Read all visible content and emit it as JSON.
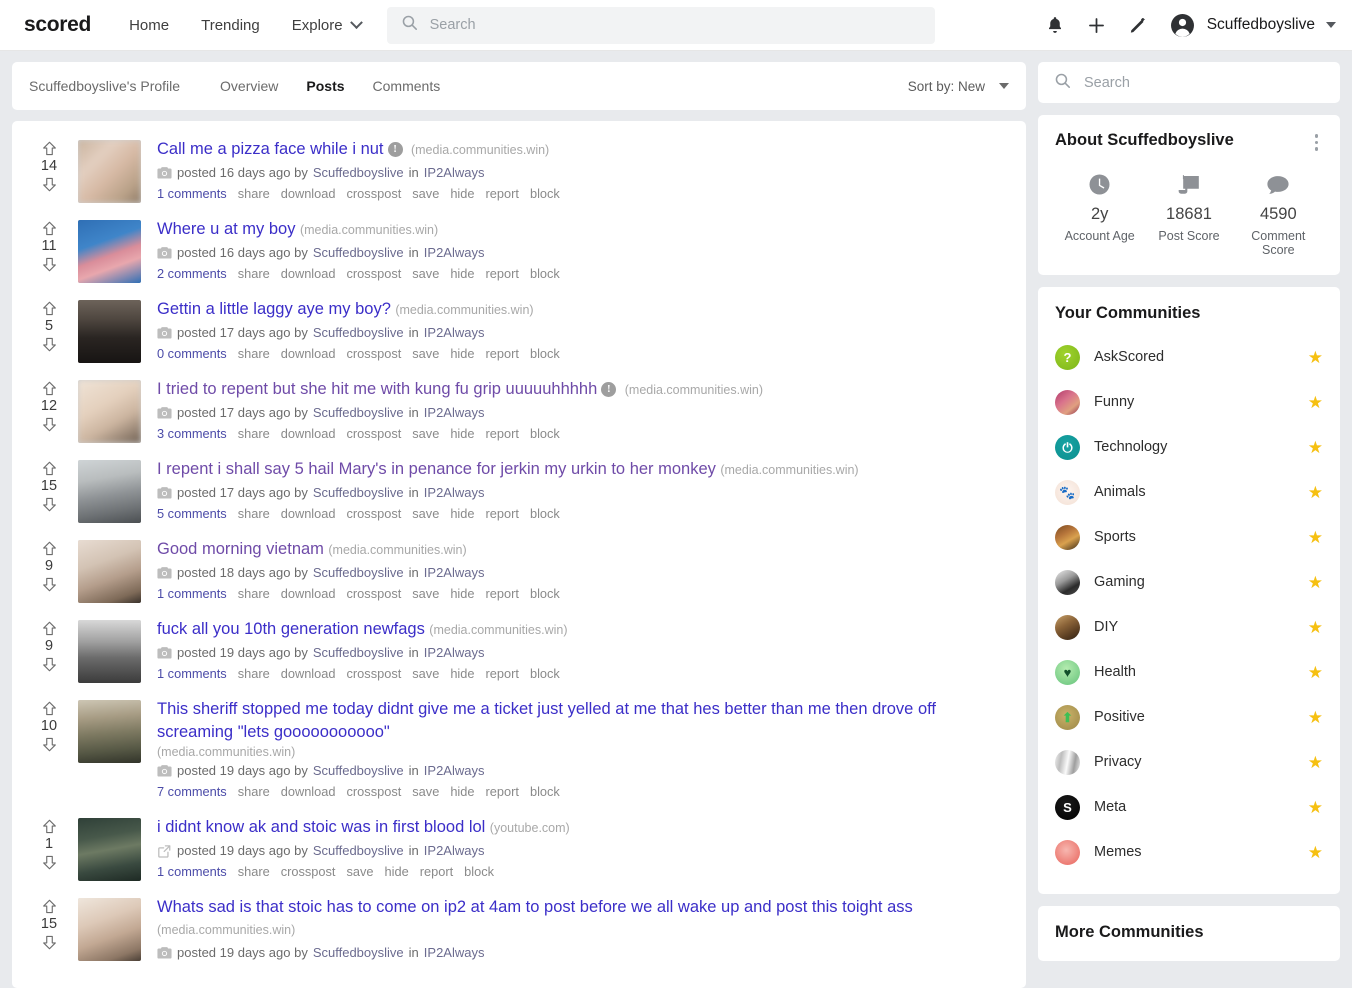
{
  "navbar": {
    "brand": "scored",
    "links": [
      {
        "label": "Home",
        "name": "nav-home"
      },
      {
        "label": "Trending",
        "name": "nav-trending"
      }
    ],
    "explore": "Explore",
    "search_placeholder": "Search",
    "search_value": "",
    "icons": [
      "bell-icon",
      "plus-icon",
      "pencil-icon",
      "account-icon"
    ],
    "username": "Scuffedboyslive"
  },
  "profile_header": {
    "profile_label": "Scuffedboyslive's Profile",
    "tabs": [
      {
        "label": "Overview",
        "active": false
      },
      {
        "label": "Posts",
        "active": true
      },
      {
        "label": "Comments",
        "active": false
      }
    ],
    "sort_label": "Sort by: New"
  },
  "posts": [
    {
      "score": "14",
      "title": "Call me a pizza face while i nut",
      "nsfw": true,
      "domain": "(media.communities.win)",
      "kind": "camera-icon",
      "posted": "posted 16 days ago by",
      "author": "Scuffedboyslive",
      "in": "in",
      "community": "IP2Always",
      "comments": "1 comments",
      "actions": [
        "share",
        "download",
        "crosspost",
        "save",
        "hide",
        "report",
        "block"
      ],
      "thumb": "blurred-nsfw-thumbnail",
      "thumb_css": "linear-gradient(135deg,#c9b39e 0%,#e3cfc0 30%,#d6b9a4 55%,#b9a188 80%,#8e7a66 100%)",
      "visited": false
    },
    {
      "score": "11",
      "title": "Where u at my boy",
      "nsfw": false,
      "domain": "(media.communities.win)",
      "kind": "camera-icon",
      "posted": "posted 16 days ago by",
      "author": "Scuffedboyslive",
      "in": "in",
      "community": "IP2Always",
      "comments": "2 comments",
      "actions": [
        "share",
        "download",
        "crosspost",
        "save",
        "hide",
        "report",
        "block"
      ],
      "thumb": "pink-octopus-on-blue-thumbnail",
      "thumb_css": "linear-gradient(160deg,#2f6fb5 0%,#3f85c9 35%,#d98d9a 55%,#e8a7ad 70%,#2f6fb5 100%)",
      "visited": false
    },
    {
      "score": "5",
      "title": "Gettin a little laggy aye my boy?",
      "nsfw": false,
      "domain": "(media.communities.win)",
      "kind": "camera-icon",
      "posted": "posted 17 days ago by",
      "author": "Scuffedboyslive",
      "in": "in",
      "community": "IP2Always",
      "comments": "0 comments",
      "actions": [
        "share",
        "download",
        "crosspost",
        "save",
        "hide",
        "report",
        "block"
      ],
      "thumb": "man-in-dark-room-thumbnail",
      "thumb_css": "linear-gradient(180deg,#6d635a 0%,#4f4740 30%,#2a2522 60%,#171413 100%)",
      "visited": false
    },
    {
      "score": "12",
      "title": "I tried to repent but she hit me with kung fu grip uuuuuhhhhh",
      "nsfw": true,
      "domain": "(media.communities.win)",
      "kind": "camera-icon",
      "posted": "posted 17 days ago by",
      "author": "Scuffedboyslive",
      "in": "in",
      "community": "IP2Always",
      "comments": "3 comments",
      "actions": [
        "share",
        "download",
        "crosspost",
        "save",
        "hide",
        "report",
        "block"
      ],
      "thumb": "blurred-nsfw-thumbnail",
      "thumb_css": "linear-gradient(150deg,#efe3d6 0%,#e4d0bd 40%,#cbb49f 65%,#6e5f52 100%)",
      "visited": true
    },
    {
      "score": "15",
      "title": "I repent i shall say 5 hail Mary's in penance for jerkin my urkin to her monkey",
      "nsfw": false,
      "domain": "(media.communities.win)",
      "kind": "camera-icon",
      "posted": "posted 17 days ago by",
      "author": "Scuffedboyslive",
      "in": "in",
      "community": "IP2Always",
      "comments": "5 comments",
      "actions": [
        "share",
        "download",
        "crosspost",
        "save",
        "hide",
        "report",
        "block"
      ],
      "thumb": "woman-in-gym-mirror-thumbnail",
      "thumb_css": "linear-gradient(170deg,#cfd4d6 0%,#b9bdbe 30%,#8f9396 55%,#6e7275 78%,#4b4f52 100%)",
      "visited": true
    },
    {
      "score": "9",
      "title": "Good morning vietnam",
      "nsfw": false,
      "domain": "(media.communities.win)",
      "kind": "camera-icon",
      "posted": "posted 18 days ago by",
      "author": "Scuffedboyslive",
      "in": "in",
      "community": "IP2Always",
      "comments": "1 comments",
      "actions": [
        "share",
        "download",
        "crosspost",
        "save",
        "hide",
        "report",
        "block"
      ],
      "thumb": "person-thumbnail",
      "thumb_css": "linear-gradient(160deg,#e8dcd2 0%,#d3c3b4 35%,#b49d8b 60%,#7e6a58 85%,#3a322c 100%)",
      "visited": true
    },
    {
      "score": "9",
      "title": "fuck all you 10th generation newfags",
      "nsfw": false,
      "domain": "(media.communities.win)",
      "kind": "camera-icon",
      "posted": "posted 19 days ago by",
      "author": "Scuffedboyslive",
      "in": "in",
      "community": "IP2Always",
      "comments": "1 comments",
      "actions": [
        "share",
        "download",
        "crosspost",
        "save",
        "hide",
        "report",
        "block"
      ],
      "thumb": "black-and-white-boy-with-gun-thumbnail",
      "thumb_css": "linear-gradient(180deg,#d8d8d8 0%,#9f9f9f 35%,#6b6b6b 60%,#3b3b3b 100%)",
      "visited": false
    },
    {
      "score": "10",
      "title": "This sheriff stopped me today didnt give me a ticket just yelled at me that hes better than me then drove off screaming \"lets gooooooooooo\"",
      "nsfw": false,
      "domain": "(media.communities.win)",
      "domain_below": true,
      "kind": "camera-icon",
      "posted": "posted 19 days ago by",
      "author": "Scuffedboyslive",
      "in": "in",
      "community": "IP2Always",
      "comments": "7 comments",
      "actions": [
        "share",
        "download",
        "crosspost",
        "save",
        "hide",
        "report",
        "block"
      ],
      "thumb": "sheriff-with-hat-thumbnail",
      "thumb_css": "linear-gradient(175deg,#cdc6b4 0%,#a79c84 28%,#7e7a62 52%,#565845 78%,#32342a 100%)",
      "visited": false
    },
    {
      "score": "1",
      "title": "i didnt know ak and stoic was in first blood lol",
      "nsfw": false,
      "domain": "(youtube.com)",
      "kind": "link-icon",
      "posted": "posted 19 days ago by",
      "author": "Scuffedboyslive",
      "in": "in",
      "community": "IP2Always",
      "comments": "1 comments",
      "actions": [
        "share",
        "crosspost",
        "save",
        "hide",
        "report",
        "block"
      ],
      "thumb": "youtube-video-thumbnail",
      "thumb_css": "linear-gradient(170deg,#2f4038 0%,#47584a 30%,#6d7a63 50%,#3a4a40 75%,#1e2a24 100%)",
      "visited": false
    },
    {
      "score": "15",
      "title": "Whats sad is that stoic has to come on ip2 at 4am to post before we all wake up and post this toight ass",
      "nsfw": false,
      "domain": "(media.communities.win)",
      "kind": "camera-icon",
      "posted": "posted 19 days ago by",
      "author": "Scuffedboyslive",
      "in": "in",
      "community": "IP2Always",
      "comments": "",
      "actions": [],
      "thumb": "person-thumbnail",
      "thumb_css": "linear-gradient(160deg,#efe6dc 0%,#ddc9b8 35%,#c2a893 60%,#8d7765 85%,#4a3f36 100%)",
      "visited": false
    }
  ],
  "sidebar": {
    "search_placeholder": "Search",
    "search_value": "",
    "about": {
      "title": "About Scuffedboyslive",
      "menu_icon": "kebab-menu-icon",
      "stats": [
        {
          "icon": "clock-icon",
          "value": "2y",
          "label": "Account Age"
        },
        {
          "icon": "scroll-icon",
          "value": "18681",
          "label": "Post Score"
        },
        {
          "icon": "comment-bubble-icon",
          "value": "4590",
          "label": "Comment Score"
        }
      ]
    },
    "communities": {
      "title": "Your Communities",
      "items": [
        {
          "name": "AskScored",
          "avatar_css": "radial-gradient(circle at 40% 35%, #a0d32e, #7cb518)",
          "glyph": "?",
          "glyph_color": "#ffffff",
          "starred": true
        },
        {
          "name": "Funny",
          "avatar_css": "linear-gradient(140deg,#b13a6a 0%,#d9738c 40%,#e0a080 70%,#8c2b4e 100%)",
          "glyph": "",
          "glyph_color": "",
          "starred": true
        },
        {
          "name": "Technology",
          "avatar_css": "radial-gradient(circle at 45% 35%, #17a2a2, #0b8f8f)",
          "glyph": "⏻",
          "glyph_color": "#ffffff",
          "starred": true
        },
        {
          "name": "Animals",
          "avatar_css": "radial-gradient(circle at 50% 45%, #fdf4ef, #f3e0d4)",
          "glyph": "🐾",
          "glyph_color": "#8a4b2a",
          "starred": true
        },
        {
          "name": "Sports",
          "avatar_css": "linear-gradient(150deg,#7a4a20 0%,#b5743a 35%,#d9a14e 60%,#3a2a18 100%)",
          "glyph": "",
          "glyph_color": "",
          "starred": true
        },
        {
          "name": "Gaming",
          "avatar_css": "linear-gradient(150deg,#ededed 0%,#9a9a9a 40%,#2b2b2b 70%,#4d4d4d 100%)",
          "glyph": "",
          "glyph_color": "",
          "starred": true
        },
        {
          "name": "DIY",
          "avatar_css": "linear-gradient(150deg,#c9a26b 0%,#8a6338 40%,#5c3f22 70%,#2f2013 100%)",
          "glyph": "",
          "glyph_color": "",
          "starred": true
        },
        {
          "name": "Health",
          "avatar_css": "radial-gradient(circle at 45% 35%, #b5ecb0, #64c27a)",
          "glyph": "♥",
          "glyph_color": "#11502b",
          "starred": true
        },
        {
          "name": "Positive",
          "avatar_css": "radial-gradient(circle at 45% 40%, #cbb36a, #9a8646)",
          "glyph": "⬆",
          "glyph_color": "#3fbf54",
          "starred": true
        },
        {
          "name": "Privacy",
          "avatar_css": "linear-gradient(100deg,#f2f2f2 0%,#bdbdbd 25%,#fafafa 50%,#9e9e9e 75%,#ededed 100%)",
          "glyph": "",
          "glyph_color": "",
          "starred": true
        },
        {
          "name": "Meta",
          "avatar_css": "radial-gradient(circle at 45% 35%, #1b1b1b, #000000)",
          "glyph": "S",
          "glyph_color": "#ffffff",
          "starred": true
        },
        {
          "name": "Memes",
          "avatar_css": "radial-gradient(circle at 45% 40%, #f7b7b0, #e8625a)",
          "glyph": "",
          "glyph_color": "",
          "starred": true
        }
      ]
    },
    "more_communities_title": "More Communities"
  },
  "colors": {
    "page_bg": "#e8eaed",
    "card_bg": "#ffffff",
    "link": "#3b2ec8",
    "link_visited": "#6f4ba8",
    "muted": "#8a8a8a",
    "star": "#f6c011"
  }
}
